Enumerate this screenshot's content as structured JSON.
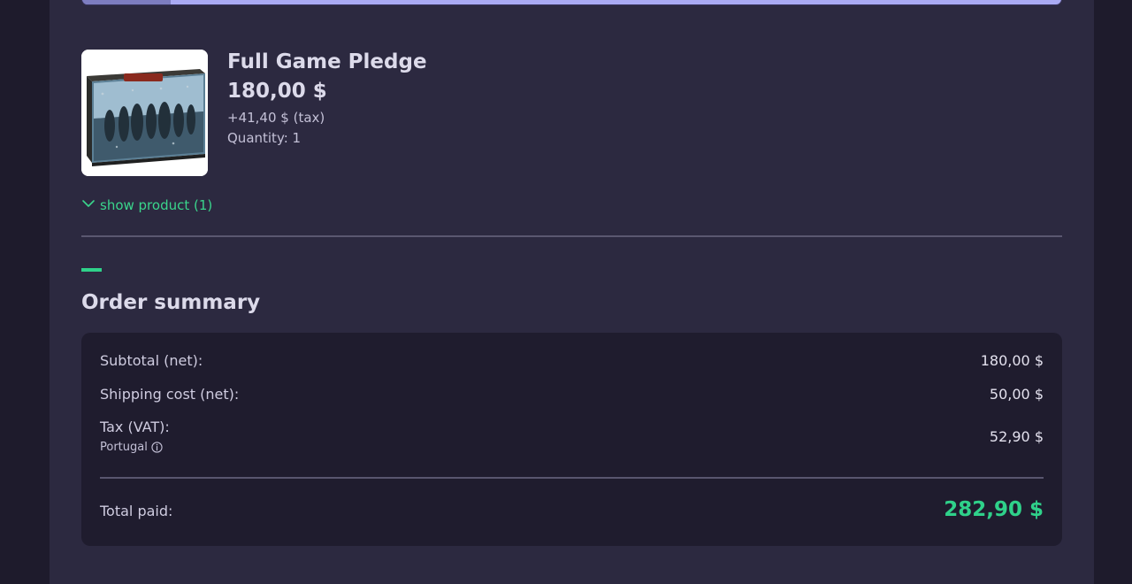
{
  "progress": {
    "fraction": 0.09
  },
  "product": {
    "image_alt": "Full Game Pledge box art",
    "title": "Full Game Pledge",
    "price": "180,00 $",
    "tax": "+41,40 $ (tax)",
    "quantity": "Quantity: 1",
    "show_product_label": "show product (1)"
  },
  "order_summary": {
    "title": "Order summary",
    "rows": [
      {
        "label": "Subtotal (net):",
        "value": "180,00 $"
      },
      {
        "label": "Shipping cost (net):",
        "value": "50,00 $"
      },
      {
        "label": "Tax (VAT):",
        "sublabel": "Portugal",
        "value": "52,90 $"
      }
    ],
    "total_label": "Total paid:",
    "total_value": "282,90 $"
  },
  "colors": {
    "accent_green": "#2fd18a",
    "panel_bg": "#2c2940",
    "card_bg": "#1f1c2e",
    "progress_track": "#aaaaf4",
    "progress_fill": "#7d7dc0"
  },
  "icons": {
    "expand": "chevron-down-icon",
    "info": "info-icon"
  }
}
